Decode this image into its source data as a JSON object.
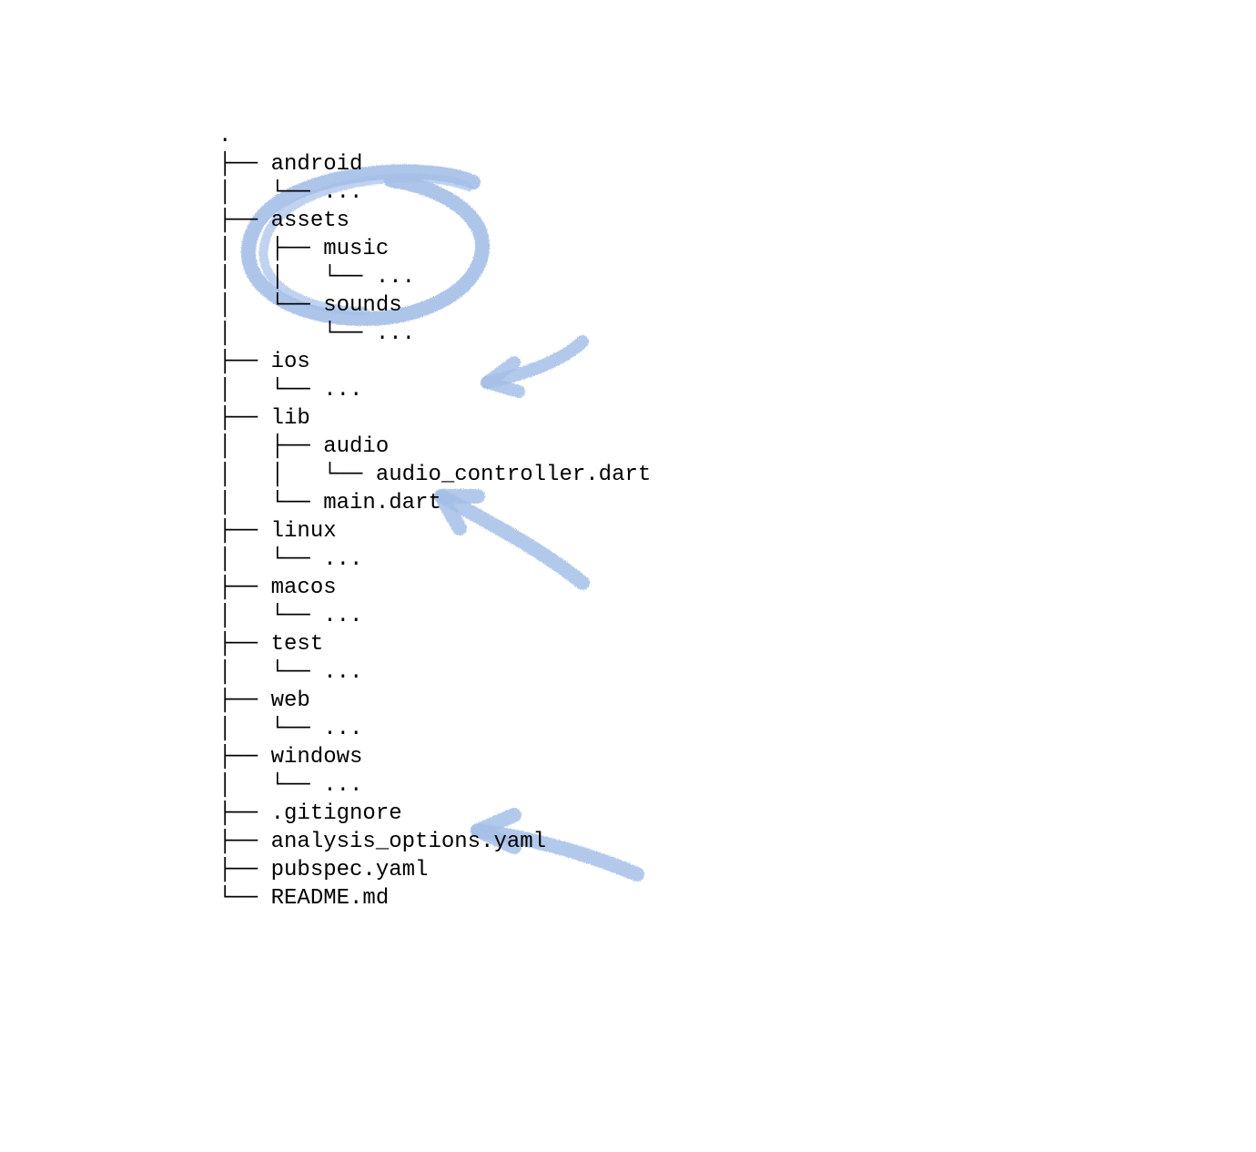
{
  "tree": {
    "lines": [
      ".",
      "├── android",
      "│   └── ...",
      "├── assets",
      "│   ├── music",
      "│   │   └── ...",
      "│   └── sounds",
      "│       └── ...",
      "├── ios",
      "│   └── ...",
      "├── lib",
      "│   ├── audio",
      "│   │   └── audio_controller.dart",
      "│   └── main.dart",
      "├── linux",
      "│   └── ...",
      "├── macos",
      "│   └── ...",
      "├── test",
      "│   └── ...",
      "├── web",
      "│   └── ...",
      "├── windows",
      "│   └── ...",
      "├── .gitignore",
      "├── analysis_options.yaml",
      "├── pubspec.yaml",
      "└── README.md"
    ]
  },
  "annotations": {
    "color": "#a5bfe8",
    "items": [
      {
        "type": "circle",
        "target": "assets"
      },
      {
        "type": "arrow",
        "target": "lib-audio"
      },
      {
        "type": "arrow",
        "target": "main-dart"
      },
      {
        "type": "arrow",
        "target": "pubspec-yaml"
      }
    ]
  }
}
